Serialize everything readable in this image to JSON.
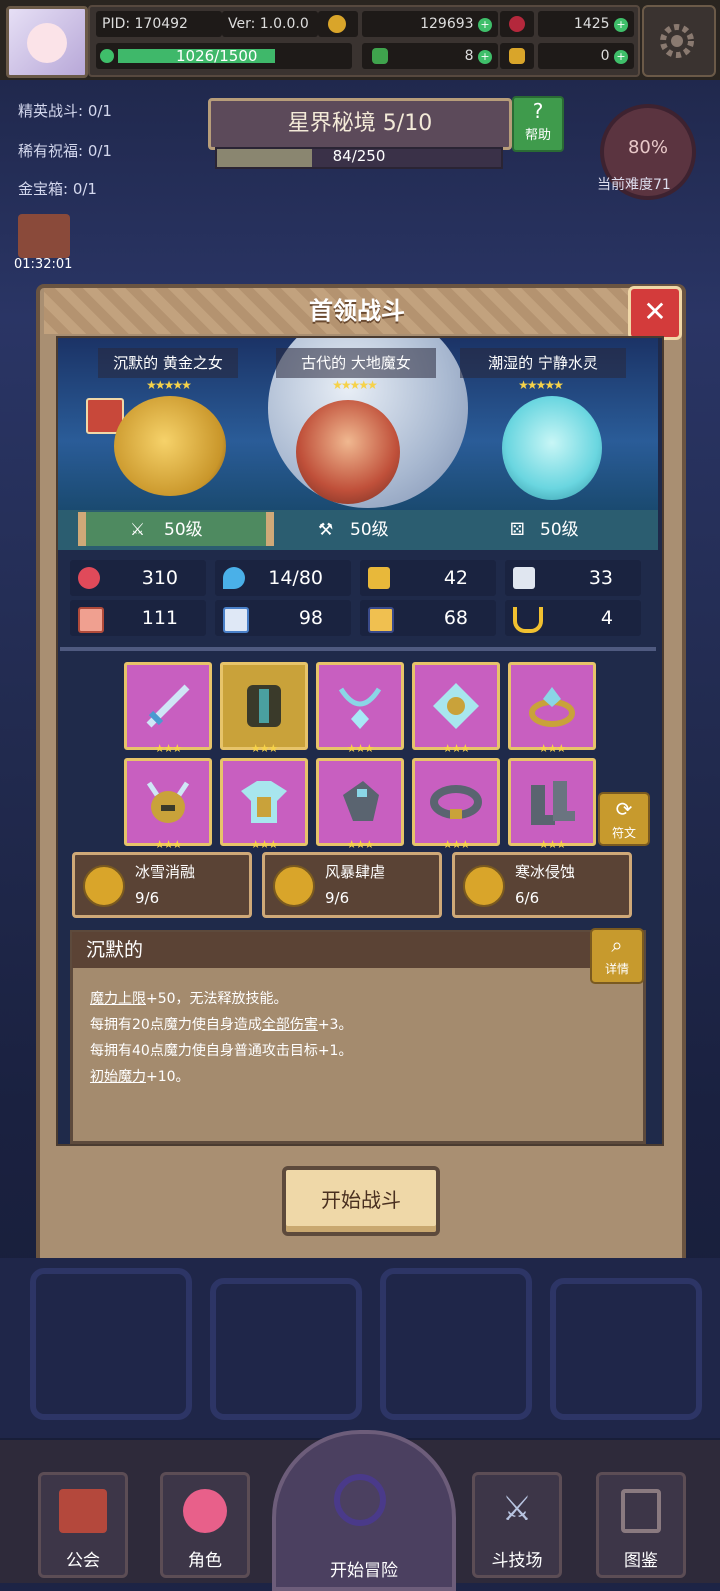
{
  "topbar": {
    "pid": "PID: 170492",
    "version": "Ver: 1.0.0.0",
    "stamina": "1026/1500",
    "stamina_ratio": 0.684,
    "coins": "129693",
    "gems": "1425",
    "clover": "8",
    "keys": "0"
  },
  "side": {
    "elite": "精英战斗: 0/1",
    "rare": "稀有祝福: 0/1",
    "chest": "金宝箱: 0/1",
    "timer": "01:32:01"
  },
  "stage": {
    "title": "星界秘境 5/10",
    "progress": "84/250",
    "progress_ratio": 0.336,
    "help": "帮助",
    "difficulty_pct": "80%",
    "difficulty_label": "当前难度71"
  },
  "dialog": {
    "title": "首领战斗",
    "bosses": [
      {
        "name": "沉默的 黄金之女",
        "level": "50级"
      },
      {
        "name": "古代的 大地魔女",
        "level": "50级"
      },
      {
        "name": "潮湿的 宁静水灵",
        "level": "50级"
      }
    ],
    "stars5": "★★★★★",
    "stats": [
      "310",
      "14/80",
      "42",
      "33",
      "111",
      "98",
      "68",
      "4"
    ],
    "stars3": "★★★",
    "rune_label": "符文",
    "sets": [
      {
        "name": "冰雪消融",
        "count": "9/6"
      },
      {
        "name": "风暴肆虐",
        "count": "9/6"
      },
      {
        "name": "寒冰侵蚀",
        "count": "6/6"
      }
    ],
    "desc_title": "沉默的",
    "detail_label": "详情",
    "desc": {
      "l1a": "魔力上限",
      "l1b": "+50，无法释放技能。",
      "l2a": "每拥有20点魔力使自身造成",
      "l2b": "全部伤害",
      "l2c": "+3。",
      "l3": "每拥有40点魔力使自身普通攻击目标+1。",
      "l4a": "初始魔力",
      "l4b": "+10。"
    },
    "start": "开始战斗"
  },
  "nav": {
    "guild": "公会",
    "role": "角色",
    "adventure": "开始冒险",
    "arena": "斗技场",
    "codex": "图鉴"
  },
  "colors": {
    "accent": "#c79a2d",
    "close": "#d33b3b",
    "slot_purple": "#c85fc0"
  }
}
